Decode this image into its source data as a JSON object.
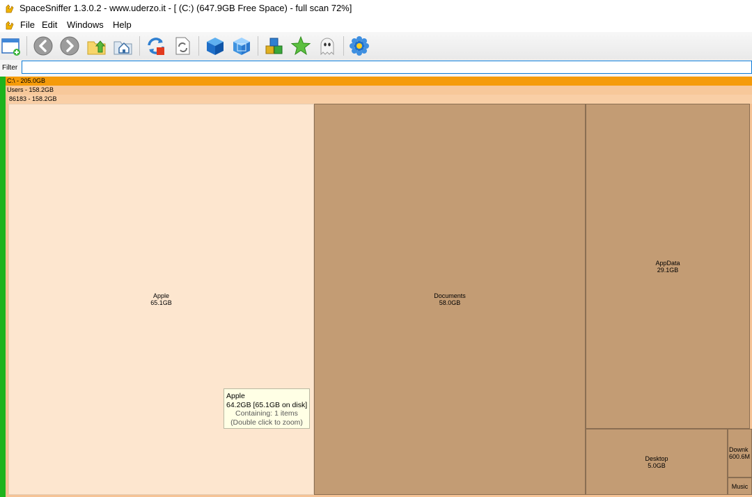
{
  "window": {
    "title": "SpaceSniffer 1.3.0.2 - www.uderzo.it - [ (C:) (647.9GB Free Space) - full scan 72%]"
  },
  "menu": {
    "items": [
      "File",
      "Edit",
      "Windows",
      "Help"
    ]
  },
  "toolbar": {
    "buttons": [
      "new-window-icon",
      "back-icon",
      "forward-icon",
      "parent-folder-icon",
      "home-folder-icon",
      "refresh-icon",
      "refresh-document-icon",
      "cube-solid-icon",
      "cube-transparent-icon",
      "boxes-icon",
      "star-icon",
      "ghost-icon",
      "gear-flower-icon"
    ]
  },
  "filter": {
    "label": "Filter",
    "value": ""
  },
  "treemap": {
    "levels": [
      {
        "label": "C:\\ - 205.0GB"
      },
      {
        "label": "Users - 158.2GB"
      },
      {
        "label": "86183 - 158.2GB"
      }
    ],
    "tiles": [
      {
        "name": "Apple",
        "size": "65.1GB"
      },
      {
        "name": "Documents",
        "size": "58.0GB"
      },
      {
        "name": "AppData",
        "size": "29.1GB"
      },
      {
        "name": "Desktop",
        "size": "5.0GB"
      },
      {
        "name": "Downk",
        "size": "600.6M"
      },
      {
        "name": "Music",
        "size": ""
      }
    ]
  },
  "tooltip": {
    "title": "Apple",
    "size": "64.2GB [65.1GB on disk]",
    "containing": "Containing: 1 items",
    "hint": "(Double click to zoom)"
  },
  "colors": {
    "root_bar": "#f59b0a",
    "folder_dark": "#c39c74",
    "folder_light": "#fde6cf",
    "free_space_edge": "#1db31d",
    "filter_focus": "#0a7ad8"
  }
}
